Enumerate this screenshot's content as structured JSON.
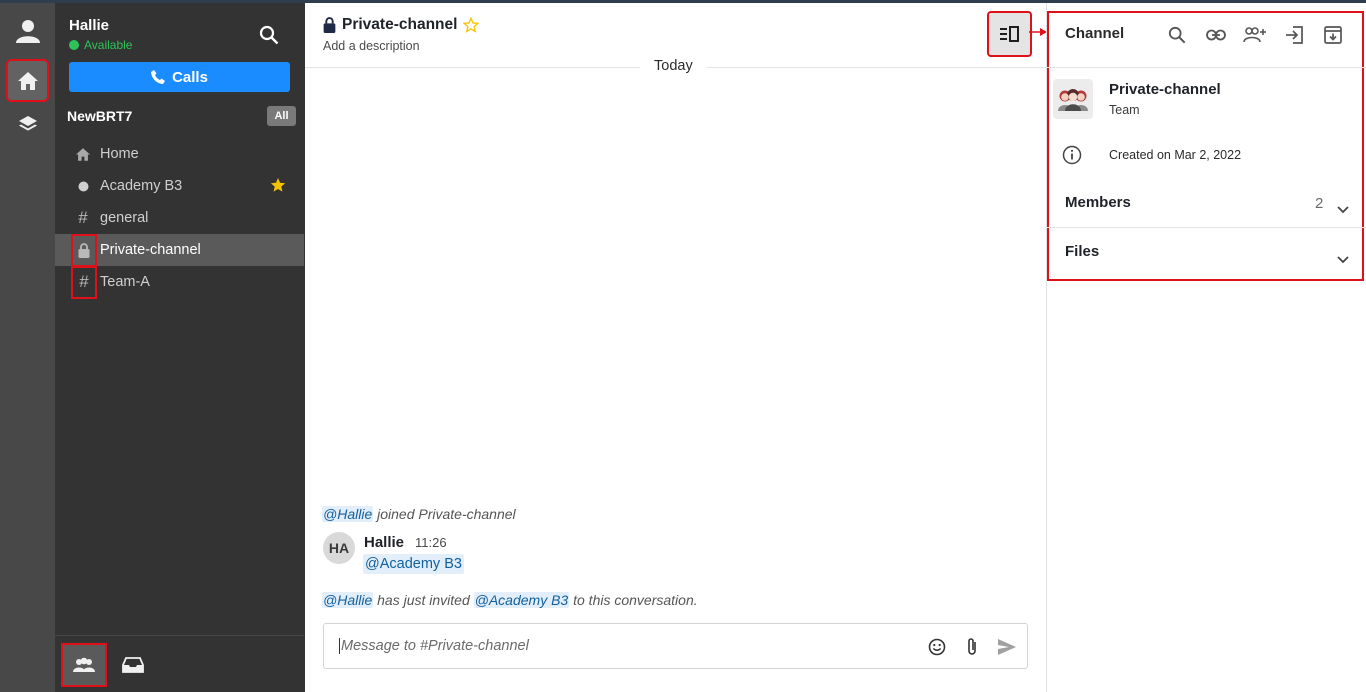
{
  "user": {
    "name": "Hallie",
    "status": "Available"
  },
  "sidebar": {
    "calls_label": "Calls",
    "team_name": "NewBRT7",
    "filter_badge": "All",
    "items": [
      {
        "label": "Home",
        "icon": "home-icon"
      },
      {
        "label": "Academy B3",
        "icon": "user-presence-dot",
        "starred": true
      },
      {
        "label": "general",
        "icon": "hash-icon"
      },
      {
        "label": "Private-channel",
        "icon": "lock-icon",
        "selected": true
      },
      {
        "label": "Team-A",
        "icon": "hash-icon"
      }
    ]
  },
  "header": {
    "channel_name": "Private-channel",
    "description": "Add a description"
  },
  "conversation": {
    "day_label": "Today",
    "join_mention": "@Hallie",
    "join_text": " joined Private-channel",
    "message": {
      "avatar": "HA",
      "author": "Hallie",
      "time": "11:26",
      "mention": "@Academy B3"
    },
    "invite_mention_1": "@Hallie",
    "invite_text_1": " has just invited ",
    "invite_mention_2": "@Academy B3",
    "invite_text_2": " to this conversation."
  },
  "composer": {
    "placeholder": "Message to #Private-channel"
  },
  "details_panel": {
    "title": "Channel",
    "channel_name": "Private-channel",
    "channel_type": "Team",
    "created": "Created on Mar 2, 2022",
    "members_label": "Members",
    "members_count": "2",
    "files_label": "Files"
  },
  "colors": {
    "accent": "#1a8cff",
    "available": "#2ec35a",
    "star": "#f5c400",
    "annotation": "#e0101a"
  }
}
